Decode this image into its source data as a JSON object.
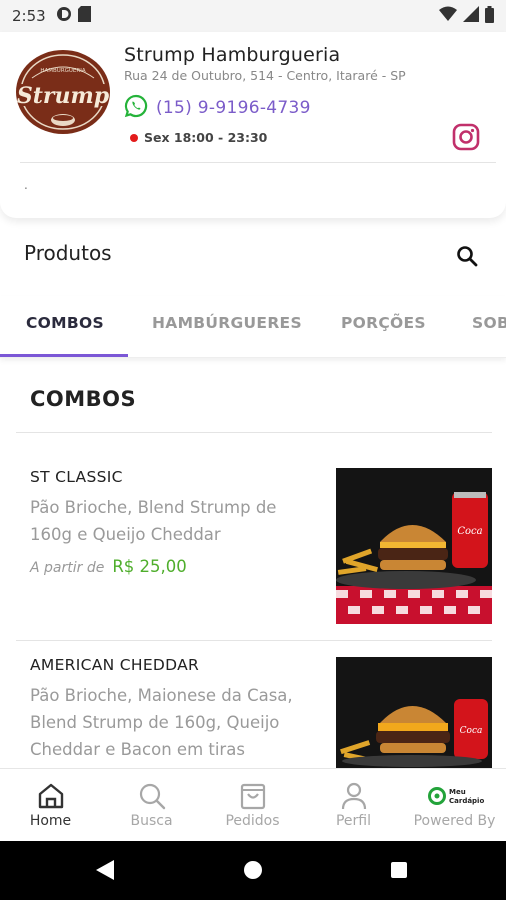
{
  "status_bar": {
    "time": "2:53",
    "icons": [
      "circle-d-icon",
      "sd-card-icon",
      "wifi-icon",
      "signal-icon",
      "battery-icon"
    ]
  },
  "store": {
    "name": "Strump Hamburgueria",
    "address": "Rua 24 de Outubro, 514 - Centro, Itararé - SP",
    "phone": "(15) 9-9196-4739",
    "hours": "Sex 18:00 - 23:30",
    "open_status_color": "#e31b1b",
    "note": ".",
    "logo_text": "Strump",
    "logo_subtext": "HAMBURGUERIA"
  },
  "products_section": {
    "title": "Produtos"
  },
  "tabs": [
    {
      "label": "COMBOS",
      "active": true
    },
    {
      "label": "HAMBÚRGUERES",
      "active": false
    },
    {
      "label": "PORÇÕES",
      "active": false
    },
    {
      "label": "SOB",
      "active": false
    }
  ],
  "category": {
    "title": "COMBOS",
    "items": [
      {
        "name": "ST CLASSIC",
        "description": "Pão Brioche, Blend Strump de 160g e Queijo Cheddar",
        "price_prefix": "A partir de",
        "price": "R$ 25,00"
      },
      {
        "name": "AMERICAN CHEDDAR",
        "description": "Pão Brioche, Maionese da Casa, Blend Strump de 160g, Queijo Cheddar e Bacon em tiras"
      }
    ]
  },
  "bottom_nav": [
    {
      "label": "Home",
      "icon": "home-icon",
      "active": true
    },
    {
      "label": "Busca",
      "icon": "search-icon",
      "active": false
    },
    {
      "label": "Pedidos",
      "icon": "shopping-bag-icon",
      "active": false
    },
    {
      "label": "Perfil",
      "icon": "user-icon",
      "active": false
    },
    {
      "label": "Powered By",
      "icon": "meu-cardapio-logo",
      "brand_text": "Meu Cardápio",
      "active": false
    }
  ],
  "colors": {
    "accent": "#7b57d6",
    "price_green": "#4fae2c",
    "whatsapp_green": "#25b33a",
    "instagram": "#c1306b"
  }
}
